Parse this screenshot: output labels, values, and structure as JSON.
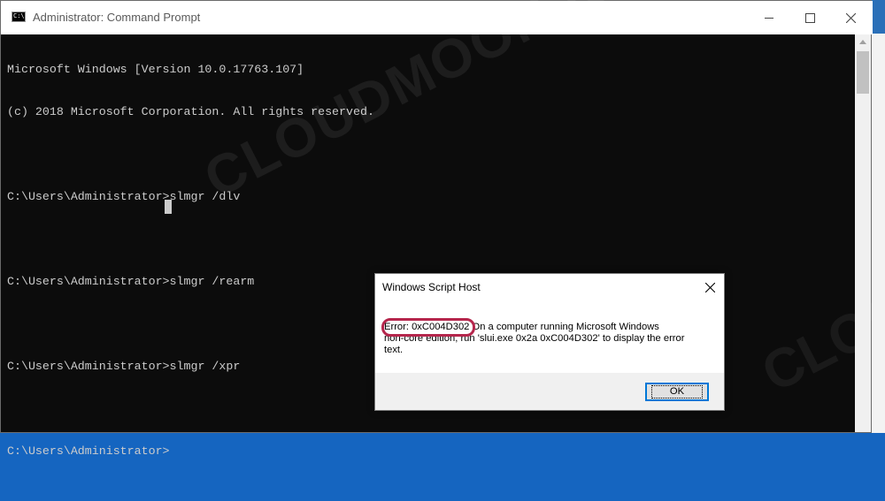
{
  "window": {
    "title": "Administrator: Command Prompt"
  },
  "console": {
    "lines": [
      "Microsoft Windows [Version 10.0.17763.107]",
      "(c) 2018 Microsoft Corporation. All rights reserved.",
      "",
      "C:\\Users\\Administrator>slmgr /dlv",
      "",
      "C:\\Users\\Administrator>slmgr /rearm",
      "",
      "C:\\Users\\Administrator>slmgr /xpr",
      "",
      "C:\\Users\\Administrator>"
    ]
  },
  "dialog": {
    "title": "Windows Script Host",
    "message_line1": "Error: 0xC004D302 On a computer running Microsoft Windows",
    "message_line2": "non-core edition, run 'slui.exe 0x2a 0xC004D302' to display the error",
    "message_line3": "text.",
    "ok_label": "OK"
  },
  "watermark": {
    "text": "CLOUDMOON.NET",
    "text_partial": "CLOUDM"
  },
  "colors": {
    "console_bg": "#0c0c0c",
    "console_text": "#cccccc",
    "highlight": "#b5264c",
    "focus_border": "#0078d7"
  }
}
